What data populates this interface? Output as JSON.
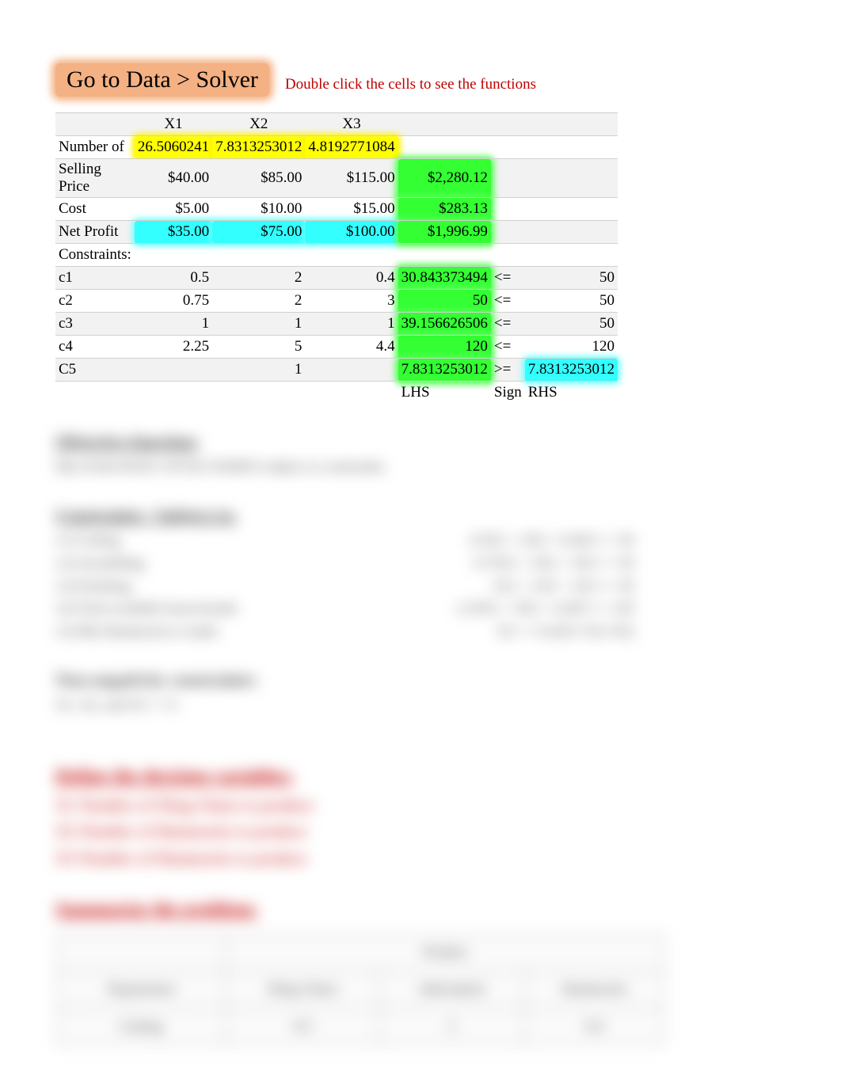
{
  "title": "Go to Data > Solver",
  "hint": "Double click the cells to see the functions",
  "headers": {
    "x1": "X1",
    "x2": "X2",
    "x3": "X3"
  },
  "labels": {
    "number_of": "Number of",
    "selling_price": "Selling Price",
    "cost": "Cost",
    "net_profit": "Net Profit",
    "constraints": "Constraints:",
    "lhs": "LHS",
    "sign": "Sign",
    "rhs": "RHS"
  },
  "number_of": {
    "x1": "26.5060241",
    "x2": "7.8313253012",
    "x3": "4.8192771084"
  },
  "selling_price": {
    "x1": "$40.00",
    "x2": "$85.00",
    "x3": "$115.00",
    "total": "$2,280.12"
  },
  "cost": {
    "x1": "$5.00",
    "x2": "$10.00",
    "x3": "$15.00",
    "total": "$283.13"
  },
  "net_profit": {
    "x1": "$35.00",
    "x2": "$75.00",
    "x3": "$100.00",
    "total": "$1,996.99"
  },
  "constraints_rows": [
    {
      "name": "c1",
      "x1": "0.5",
      "x2": "2",
      "x3": "0.4",
      "lhs": "30.843373494",
      "sign": "<=",
      "rhs": "50"
    },
    {
      "name": "c2",
      "x1": "0.75",
      "x2": "2",
      "x3": "3",
      "lhs": "50",
      "sign": "<=",
      "rhs": "50"
    },
    {
      "name": "c3",
      "x1": "1",
      "x2": "1",
      "x3": "1",
      "lhs": "39.156626506",
      "sign": "<=",
      "rhs": "50"
    },
    {
      "name": "c4",
      "x1": "2.25",
      "x2": "5",
      "x3": "4.4",
      "lhs": "120",
      "sign": "<=",
      "rhs": "120"
    },
    {
      "name": "C5",
      "x1": "",
      "x2": "1",
      "x3": "",
      "lhs": "7.8313253012",
      "sign": ">=",
      "rhs": "7.8313253012"
    }
  ],
  "blur": {
    "obj_h": "Objective function:",
    "obj_line": "Max Profit $35X1+$75X2+$100X3 subject to constraints",
    "cons_h": "Constraints / Subject to:",
    "cons_left": [
      "c1) Cutting",
      "c2) Assembling",
      "c3) Finishing",
      "c4) Total available hours/month",
      "c5) Min Hammocks to make"
    ],
    "cons_right": [
      "0.5X1 + 2X2 + 0.4X3 <= 50",
      "0.75X1 + 2X2 + 3X3 <= 50",
      "1X1 + 1X2 + 1X3 <= 50",
      "2.25X1 + 5X2 + 4.4X3 <= 120",
      "X2 >= 0.2(X1+X2+X3)"
    ],
    "nn_h": "Non-negativity constraints:",
    "nn_line": "X1, X2, and X3 >= 0",
    "dv_h": "Define the decision variables:",
    "dv_lines": [
      "X1 Number of Sling Chairs to produce",
      "X2 Number of Hammocks to produce",
      "X3 Number of Hammocks to produce"
    ],
    "sum_h": "Summarize the problem:",
    "bt_r1": [
      "",
      "Product",
      "",
      ""
    ],
    "bt_r2": [
      "Department",
      "Sling Chairs",
      "Adirondack",
      "Hammocks"
    ],
    "bt_r3": [
      "Cutting",
      "0.5",
      "2",
      "0.4"
    ]
  }
}
